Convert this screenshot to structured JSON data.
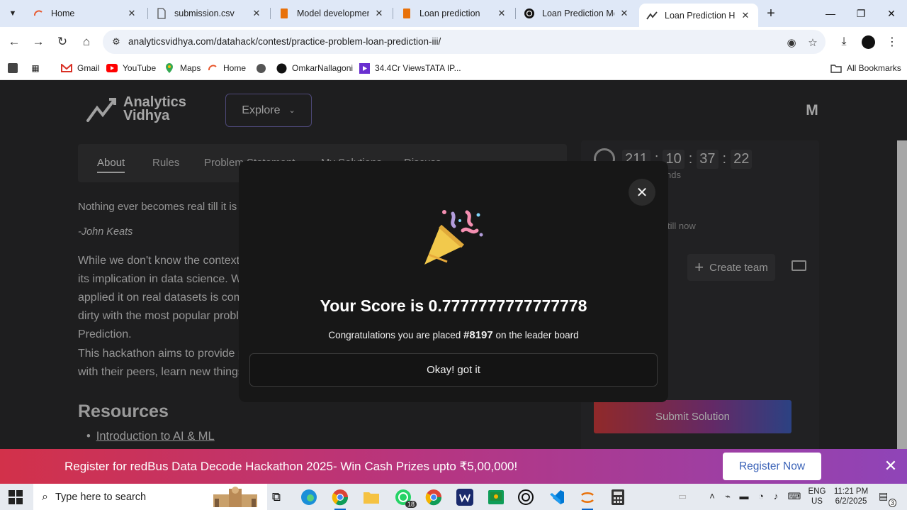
{
  "browser": {
    "tabs": [
      {
        "title": "Home",
        "icon": "analyticsvidhya-favicon",
        "active": false
      },
      {
        "title": "submission.csv",
        "icon": "file-icon",
        "active": false
      },
      {
        "title": "Model development",
        "icon": "notebook-icon",
        "active": false
      },
      {
        "title": "Loan prediction",
        "icon": "notebook-icon",
        "active": false
      },
      {
        "title": "Loan Prediction Mod",
        "icon": "chatgpt-icon",
        "active": false
      },
      {
        "title": "Loan Prediction Hack",
        "icon": "analyticsvidhya-favicon",
        "active": true
      }
    ],
    "url": "analyticsvidhya.com/datahack/contest/practice-problem-loan-prediction-iii/",
    "bookmarks": [
      {
        "label": "Gmail",
        "icon": "gmail-icon"
      },
      {
        "label": "YouTube",
        "icon": "youtube-icon"
      },
      {
        "label": "Maps",
        "icon": "maps-icon"
      },
      {
        "label": "Home",
        "icon": "analyticsvidhya-favicon"
      },
      {
        "label": "",
        "icon": "globe-icon"
      },
      {
        "label": "OmkarNallagoni",
        "icon": "github-icon"
      },
      {
        "label": "34.4Cr ViewsTATA IP...",
        "icon": "video-icon"
      }
    ],
    "all_bookmarks": "All Bookmarks"
  },
  "site": {
    "logo": {
      "line1": "Analytics",
      "line2": "Vidhya"
    },
    "explore": "Explore",
    "avatar_letter": "M",
    "tabs": [
      "About",
      "Rules",
      "Problem Statement",
      "My Solutions",
      "Discuss"
    ],
    "quote": "Nothing ever becomes real till it is experienced.",
    "author": "-John Keats",
    "para1_lines": [
      "While we don't know the context in which John Keats mentioned this, we are sure about",
      "its implication in data science. While you would have enjoyed and gained exposure to real",
      "applied it on real datasets is completely a different experience. ...you would get your hands",
      "dirty with the most popular problem. Today's problem is Loan",
      "Prediction."
    ],
    "para2_lines": [
      "This hackathon aims to provide professionals a platform to test their skills and compete",
      "with their peers, learn new things and get a way to upskill."
    ],
    "resources_title": "Resources",
    "resources": [
      "Introduction to AI & ML"
    ],
    "timer": {
      "days": "211",
      "hours": "10",
      "minutes": "37",
      "seconds": "22",
      "sub": "nds",
      "sub2": "till now"
    },
    "create_team": "Create team",
    "submit": "Submit Solution"
  },
  "modal": {
    "score_text": "Your Score is 0.7777777777777778",
    "congrats_prefix": "Congratulations you are placed ",
    "rank": "#8197",
    "congrats_suffix": " on the leader board",
    "ok_button": "Okay! got it"
  },
  "banner": {
    "text": "Register for redBus Data Decode Hackathon 2025- Win Cash Prizes upto ₹5,00,000!",
    "button": "Register Now"
  },
  "taskbar": {
    "search_placeholder": "Type here to search",
    "whatsapp_badge": "18",
    "lang_line1": "ENG",
    "lang_line2": "US",
    "time": "11:21 PM",
    "date": "6/2/2025",
    "notification_count": "3"
  }
}
